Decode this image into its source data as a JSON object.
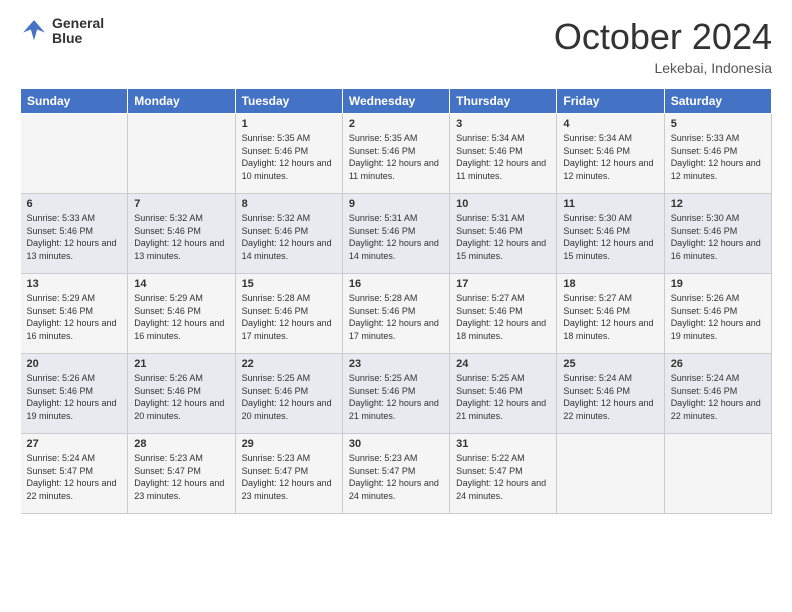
{
  "header": {
    "logo_line1": "General",
    "logo_line2": "Blue",
    "month_title": "October 2024",
    "location": "Lekebai, Indonesia"
  },
  "weekdays": [
    "Sunday",
    "Monday",
    "Tuesday",
    "Wednesday",
    "Thursday",
    "Friday",
    "Saturday"
  ],
  "weeks": [
    [
      {
        "day": "",
        "sunrise": "",
        "sunset": "",
        "daylight": ""
      },
      {
        "day": "",
        "sunrise": "",
        "sunset": "",
        "daylight": ""
      },
      {
        "day": "1",
        "sunrise": "Sunrise: 5:35 AM",
        "sunset": "Sunset: 5:46 PM",
        "daylight": "Daylight: 12 hours and 10 minutes."
      },
      {
        "day": "2",
        "sunrise": "Sunrise: 5:35 AM",
        "sunset": "Sunset: 5:46 PM",
        "daylight": "Daylight: 12 hours and 11 minutes."
      },
      {
        "day": "3",
        "sunrise": "Sunrise: 5:34 AM",
        "sunset": "Sunset: 5:46 PM",
        "daylight": "Daylight: 12 hours and 11 minutes."
      },
      {
        "day": "4",
        "sunrise": "Sunrise: 5:34 AM",
        "sunset": "Sunset: 5:46 PM",
        "daylight": "Daylight: 12 hours and 12 minutes."
      },
      {
        "day": "5",
        "sunrise": "Sunrise: 5:33 AM",
        "sunset": "Sunset: 5:46 PM",
        "daylight": "Daylight: 12 hours and 12 minutes."
      }
    ],
    [
      {
        "day": "6",
        "sunrise": "Sunrise: 5:33 AM",
        "sunset": "Sunset: 5:46 PM",
        "daylight": "Daylight: 12 hours and 13 minutes."
      },
      {
        "day": "7",
        "sunrise": "Sunrise: 5:32 AM",
        "sunset": "Sunset: 5:46 PM",
        "daylight": "Daylight: 12 hours and 13 minutes."
      },
      {
        "day": "8",
        "sunrise": "Sunrise: 5:32 AM",
        "sunset": "Sunset: 5:46 PM",
        "daylight": "Daylight: 12 hours and 14 minutes."
      },
      {
        "day": "9",
        "sunrise": "Sunrise: 5:31 AM",
        "sunset": "Sunset: 5:46 PM",
        "daylight": "Daylight: 12 hours and 14 minutes."
      },
      {
        "day": "10",
        "sunrise": "Sunrise: 5:31 AM",
        "sunset": "Sunset: 5:46 PM",
        "daylight": "Daylight: 12 hours and 15 minutes."
      },
      {
        "day": "11",
        "sunrise": "Sunrise: 5:30 AM",
        "sunset": "Sunset: 5:46 PM",
        "daylight": "Daylight: 12 hours and 15 minutes."
      },
      {
        "day": "12",
        "sunrise": "Sunrise: 5:30 AM",
        "sunset": "Sunset: 5:46 PM",
        "daylight": "Daylight: 12 hours and 16 minutes."
      }
    ],
    [
      {
        "day": "13",
        "sunrise": "Sunrise: 5:29 AM",
        "sunset": "Sunset: 5:46 PM",
        "daylight": "Daylight: 12 hours and 16 minutes."
      },
      {
        "day": "14",
        "sunrise": "Sunrise: 5:29 AM",
        "sunset": "Sunset: 5:46 PM",
        "daylight": "Daylight: 12 hours and 16 minutes."
      },
      {
        "day": "15",
        "sunrise": "Sunrise: 5:28 AM",
        "sunset": "Sunset: 5:46 PM",
        "daylight": "Daylight: 12 hours and 17 minutes."
      },
      {
        "day": "16",
        "sunrise": "Sunrise: 5:28 AM",
        "sunset": "Sunset: 5:46 PM",
        "daylight": "Daylight: 12 hours and 17 minutes."
      },
      {
        "day": "17",
        "sunrise": "Sunrise: 5:27 AM",
        "sunset": "Sunset: 5:46 PM",
        "daylight": "Daylight: 12 hours and 18 minutes."
      },
      {
        "day": "18",
        "sunrise": "Sunrise: 5:27 AM",
        "sunset": "Sunset: 5:46 PM",
        "daylight": "Daylight: 12 hours and 18 minutes."
      },
      {
        "day": "19",
        "sunrise": "Sunrise: 5:26 AM",
        "sunset": "Sunset: 5:46 PM",
        "daylight": "Daylight: 12 hours and 19 minutes."
      }
    ],
    [
      {
        "day": "20",
        "sunrise": "Sunrise: 5:26 AM",
        "sunset": "Sunset: 5:46 PM",
        "daylight": "Daylight: 12 hours and 19 minutes."
      },
      {
        "day": "21",
        "sunrise": "Sunrise: 5:26 AM",
        "sunset": "Sunset: 5:46 PM",
        "daylight": "Daylight: 12 hours and 20 minutes."
      },
      {
        "day": "22",
        "sunrise": "Sunrise: 5:25 AM",
        "sunset": "Sunset: 5:46 PM",
        "daylight": "Daylight: 12 hours and 20 minutes."
      },
      {
        "day": "23",
        "sunrise": "Sunrise: 5:25 AM",
        "sunset": "Sunset: 5:46 PM",
        "daylight": "Daylight: 12 hours and 21 minutes."
      },
      {
        "day": "24",
        "sunrise": "Sunrise: 5:25 AM",
        "sunset": "Sunset: 5:46 PM",
        "daylight": "Daylight: 12 hours and 21 minutes."
      },
      {
        "day": "25",
        "sunrise": "Sunrise: 5:24 AM",
        "sunset": "Sunset: 5:46 PM",
        "daylight": "Daylight: 12 hours and 22 minutes."
      },
      {
        "day": "26",
        "sunrise": "Sunrise: 5:24 AM",
        "sunset": "Sunset: 5:46 PM",
        "daylight": "Daylight: 12 hours and 22 minutes."
      }
    ],
    [
      {
        "day": "27",
        "sunrise": "Sunrise: 5:24 AM",
        "sunset": "Sunset: 5:47 PM",
        "daylight": "Daylight: 12 hours and 22 minutes."
      },
      {
        "day": "28",
        "sunrise": "Sunrise: 5:23 AM",
        "sunset": "Sunset: 5:47 PM",
        "daylight": "Daylight: 12 hours and 23 minutes."
      },
      {
        "day": "29",
        "sunrise": "Sunrise: 5:23 AM",
        "sunset": "Sunset: 5:47 PM",
        "daylight": "Daylight: 12 hours and 23 minutes."
      },
      {
        "day": "30",
        "sunrise": "Sunrise: 5:23 AM",
        "sunset": "Sunset: 5:47 PM",
        "daylight": "Daylight: 12 hours and 24 minutes."
      },
      {
        "day": "31",
        "sunrise": "Sunrise: 5:22 AM",
        "sunset": "Sunset: 5:47 PM",
        "daylight": "Daylight: 12 hours and 24 minutes."
      },
      {
        "day": "",
        "sunrise": "",
        "sunset": "",
        "daylight": ""
      },
      {
        "day": "",
        "sunrise": "",
        "sunset": "",
        "daylight": ""
      }
    ]
  ]
}
